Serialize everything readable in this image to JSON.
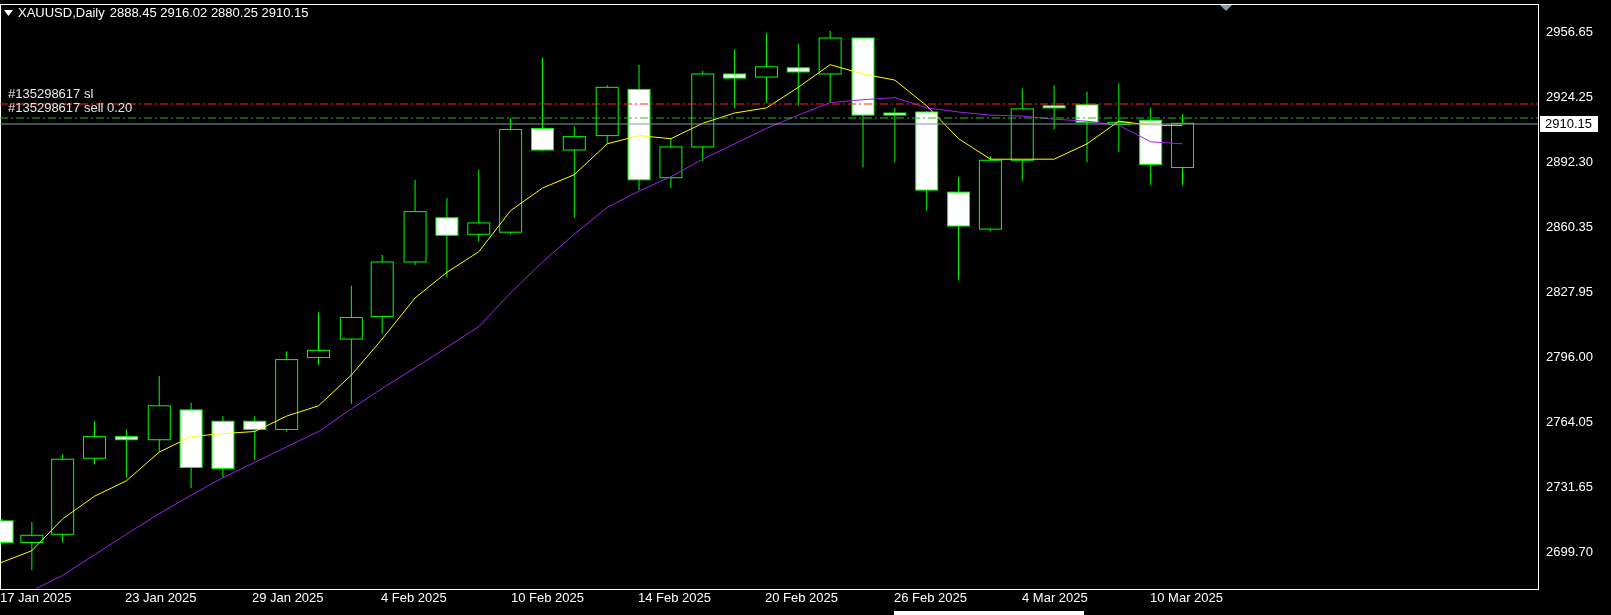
{
  "header": {
    "symbol": "XAUUSD,Daily",
    "ohlc": "2888.45 2916.02 2880.25 2910.15"
  },
  "order_lines": [
    {
      "label": "#135298617 sl",
      "kind": "stop-loss"
    },
    {
      "label": "#135298617 sell 0.20",
      "kind": "entry"
    }
  ],
  "price_axis": {
    "labels": [
      "2956.65",
      "2924.25",
      "2892.30",
      "2860.35",
      "2827.95",
      "2796.00",
      "2764.05",
      "2731.65",
      "2699.70"
    ],
    "current_price": "2910.15"
  },
  "time_axis": {
    "labels": [
      "17 Jan 2025",
      "23 Jan 2025",
      "29 Jan 2025",
      "4 Feb 2025",
      "10 Feb 2025",
      "14 Feb 2025",
      "20 Feb 2025",
      "26 Feb 2025",
      "4 Mar 2025",
      "10 Mar 2025"
    ]
  }
}
